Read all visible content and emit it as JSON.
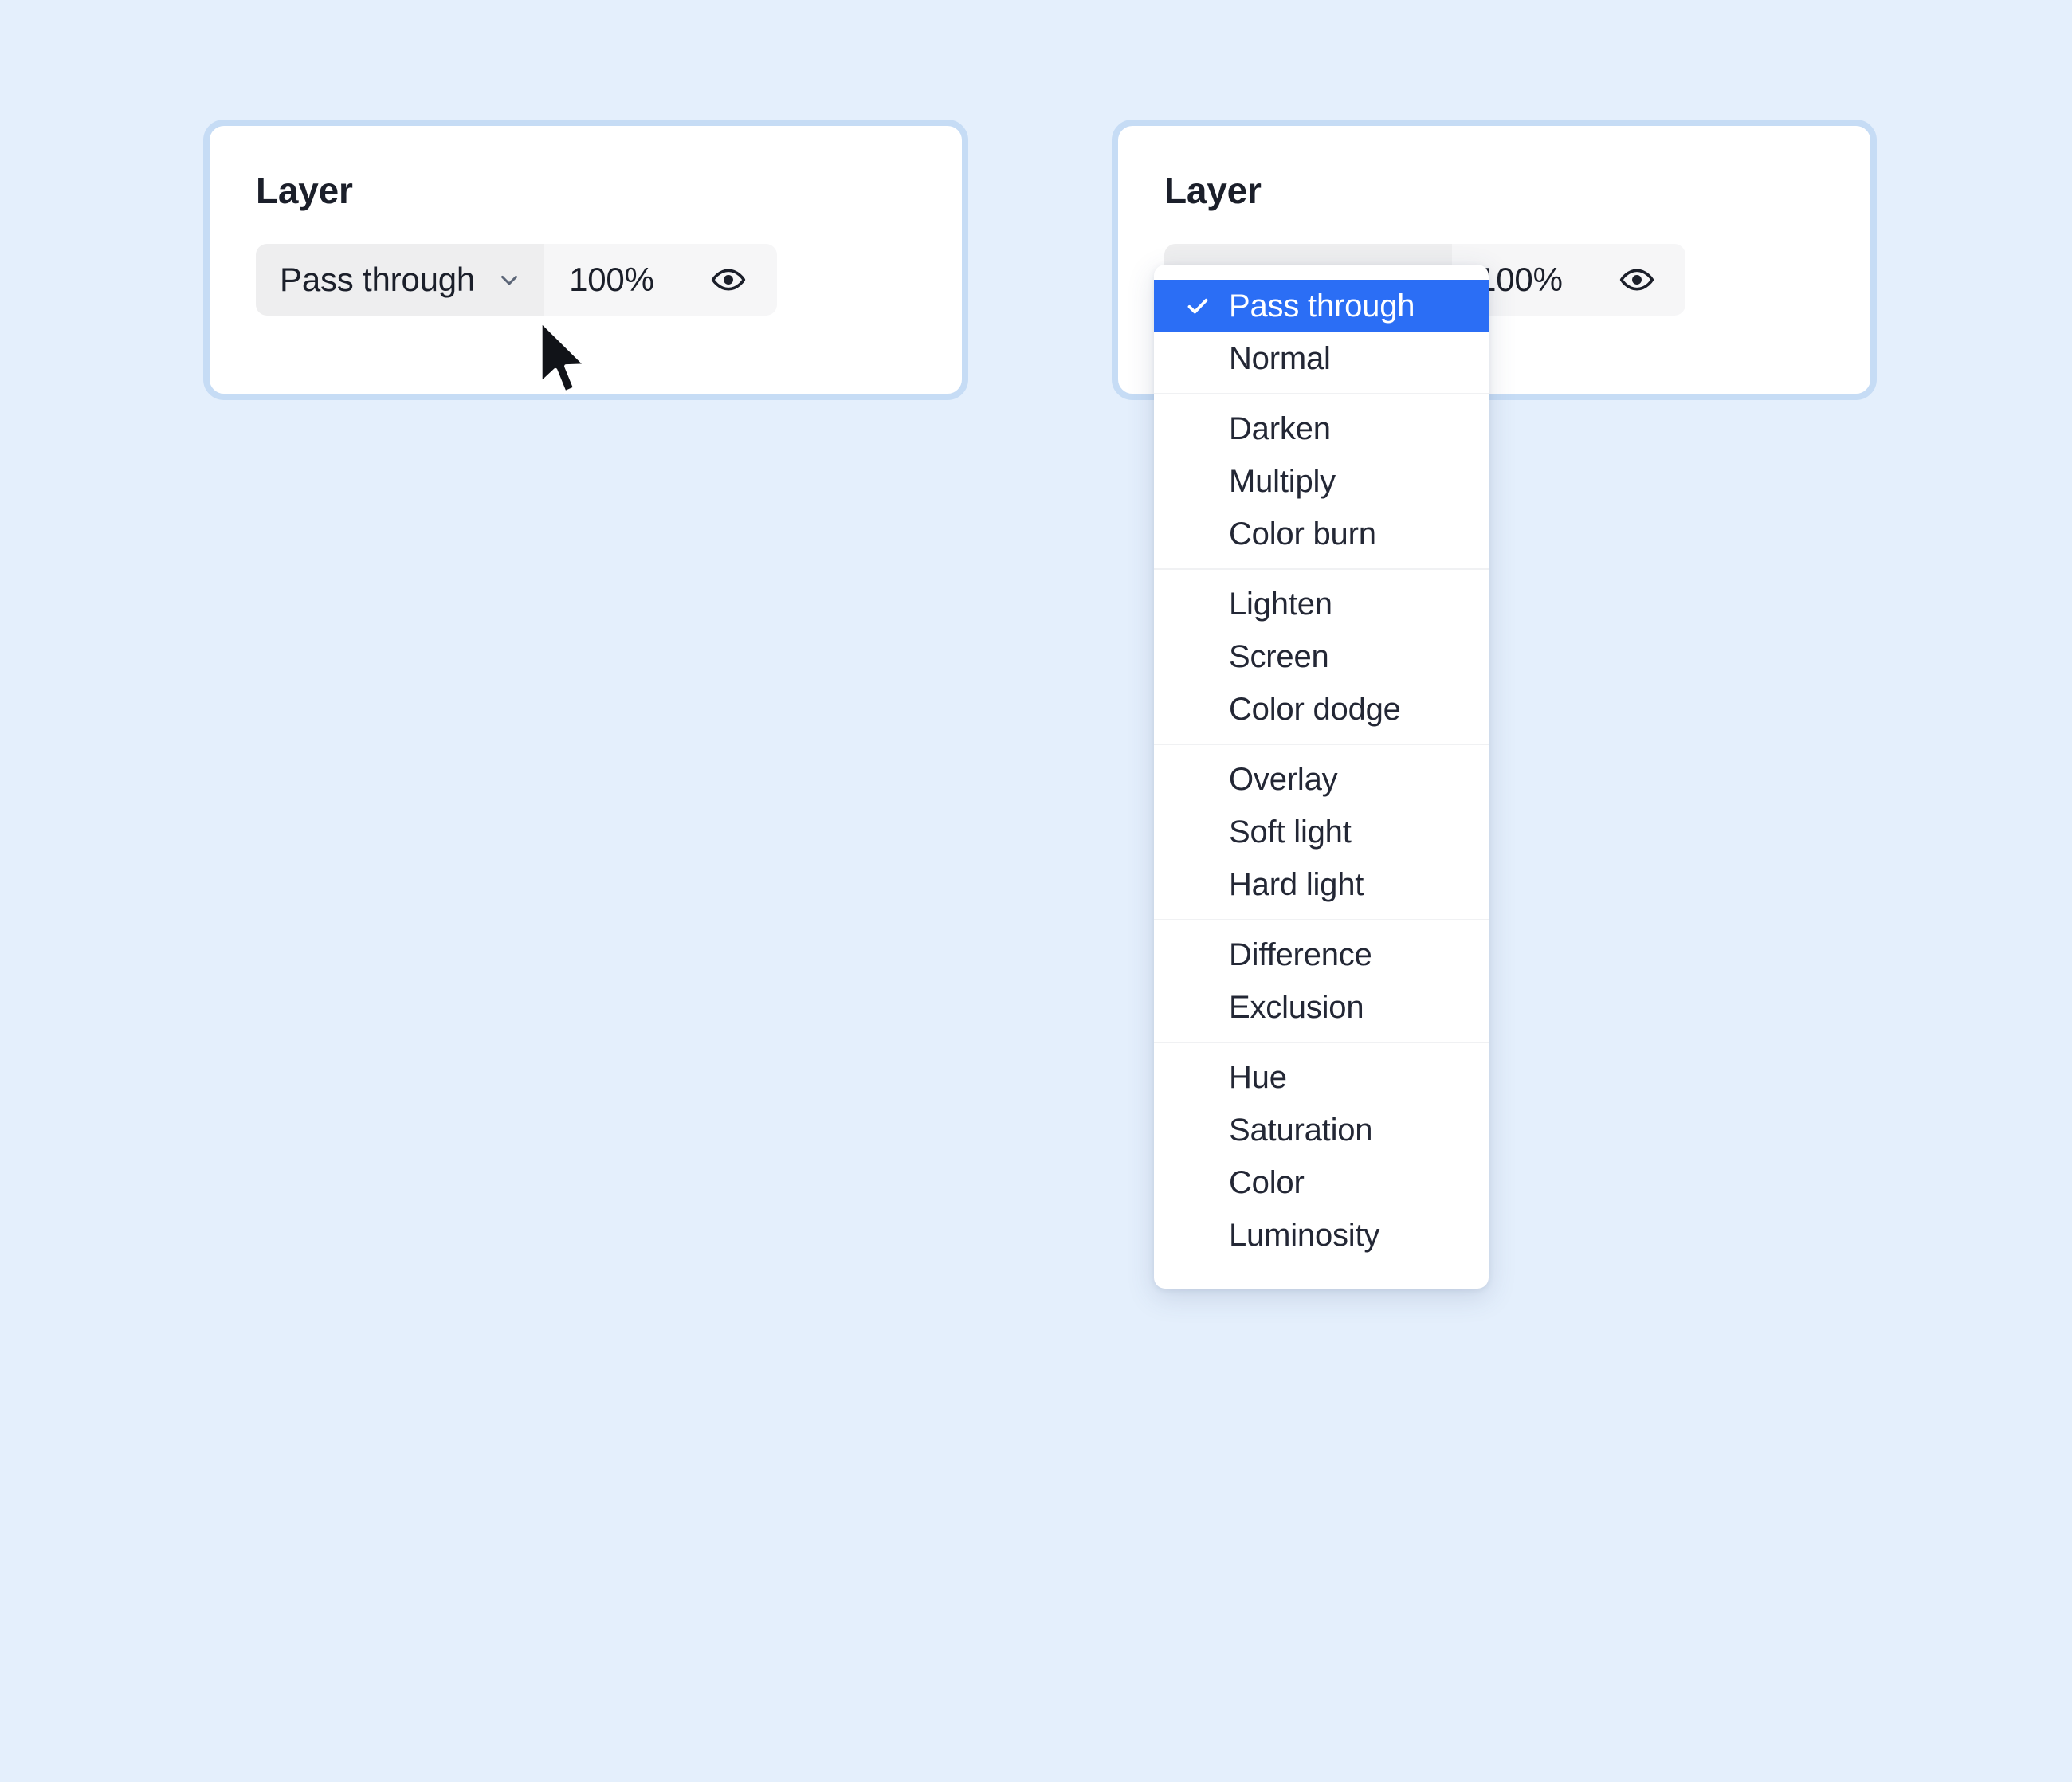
{
  "theme": {
    "page_background": "#e4effc",
    "card_border": "#c6dcf5",
    "card_background": "#ffffff",
    "accent": "#2b6ef5",
    "segment_active_background": "#eeeeef",
    "segment_inactive_background": "#f6f6f7",
    "text": "#1b1f2a"
  },
  "panels": {
    "closed": {
      "title": "Layer",
      "blend_mode": "Pass through",
      "opacity": "100%",
      "chevron_icon": "chevron-down-icon",
      "visibility_icon": "eye-icon"
    },
    "open": {
      "title": "Layer",
      "blend_mode": "Pass through",
      "opacity": "100%",
      "chevron_icon": "chevron-down-icon",
      "visibility_icon": "eye-icon"
    }
  },
  "dropdown": {
    "selected": "Pass through",
    "check_icon": "check-icon",
    "sections": [
      {
        "items": [
          "Pass through",
          "Normal"
        ]
      },
      {
        "items": [
          "Darken",
          "Multiply",
          "Color burn"
        ]
      },
      {
        "items": [
          "Lighten",
          "Screen",
          "Color dodge"
        ]
      },
      {
        "items": [
          "Overlay",
          "Soft light",
          "Hard light"
        ]
      },
      {
        "items": [
          "Difference",
          "Exclusion"
        ]
      },
      {
        "items": [
          "Hue",
          "Saturation",
          "Color",
          "Luminosity"
        ]
      }
    ]
  },
  "cursor": {
    "icon": "arrow-pointer-icon"
  }
}
